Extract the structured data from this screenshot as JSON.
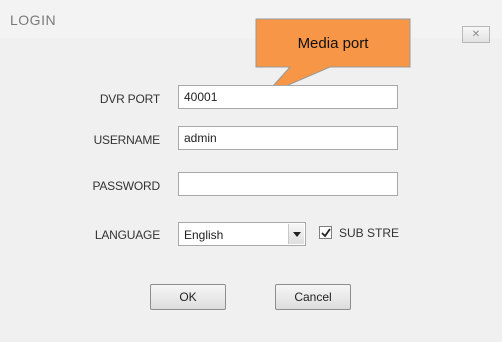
{
  "dialog": {
    "title": "LOGIN",
    "close_label": "✕"
  },
  "callout": {
    "text": "Media port",
    "fill_color": "#f79646",
    "border_color": "#9a9a9a"
  },
  "form": {
    "dvr_port": {
      "label": "DVR PORT",
      "value": "40001"
    },
    "username": {
      "label": "USERNAME",
      "value": "admin"
    },
    "password": {
      "label": "PASSWORD",
      "value": ""
    },
    "language": {
      "label": "LANGUAGE",
      "value": "English"
    },
    "sub_stream": {
      "label": "SUB STRE",
      "checked": true
    }
  },
  "buttons": {
    "ok_label": "OK",
    "cancel_label": "Cancel"
  },
  "icons": {
    "close": "close-icon",
    "dropdown": "chevron-down-icon",
    "check": "check-icon"
  }
}
